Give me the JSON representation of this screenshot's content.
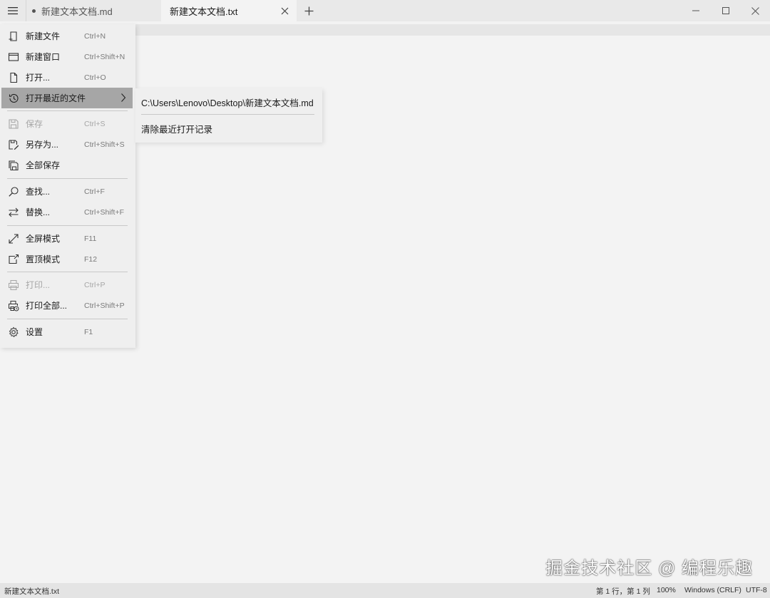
{
  "tabs": [
    {
      "label": "新建文本文档.md",
      "modified": true
    },
    {
      "label": "新建文本文档.txt",
      "active": true
    }
  ],
  "menu": {
    "items": [
      {
        "label": "新建文件",
        "shortcut": "Ctrl+N",
        "icon": "new-file-icon"
      },
      {
        "label": "新建窗口",
        "shortcut": "Ctrl+Shift+N",
        "icon": "new-window-icon"
      },
      {
        "label": "打开...",
        "shortcut": "Ctrl+O",
        "icon": "open-file-icon"
      },
      {
        "label": "打开最近的文件",
        "shortcut": "",
        "icon": "history-icon"
      },
      {
        "label": "保存",
        "shortcut": "Ctrl+S",
        "icon": "save-icon",
        "disabled": true
      },
      {
        "label": "另存为...",
        "shortcut": "Ctrl+Shift+S",
        "icon": "save-as-icon"
      },
      {
        "label": "全部保存",
        "shortcut": "",
        "icon": "save-all-icon"
      },
      {
        "label": "查找...",
        "shortcut": "Ctrl+F",
        "icon": "search-icon"
      },
      {
        "label": "替换...",
        "shortcut": "Ctrl+Shift+F",
        "icon": "replace-icon"
      },
      {
        "label": "全屏模式",
        "shortcut": "F11",
        "icon": "fullscreen-icon"
      },
      {
        "label": "置顶模式",
        "shortcut": "F12",
        "icon": "pin-on-top-icon"
      },
      {
        "label": "打印...",
        "shortcut": "Ctrl+P",
        "icon": "print-icon",
        "disabled": true
      },
      {
        "label": "打印全部...",
        "shortcut": "Ctrl+Shift+P",
        "icon": "print-all-icon"
      },
      {
        "label": "设置",
        "shortcut": "F1",
        "icon": "gear-icon"
      }
    ]
  },
  "submenu": {
    "recent_file": "C:\\Users\\Lenovo\\Desktop\\新建文本文档.md",
    "clear": "清除最近打开记录"
  },
  "watermark": "掘金技术社区 @ 编程乐趣",
  "status": {
    "filename": "新建文本文档.txt",
    "position": "第 1 行，第 1 列",
    "zoom": "100%",
    "line_ending": "Windows (CRLF)",
    "encoding": "UTF-8"
  },
  "colors": {
    "menu_hover": "#a6a6a6",
    "background": "#f3f3f3"
  }
}
